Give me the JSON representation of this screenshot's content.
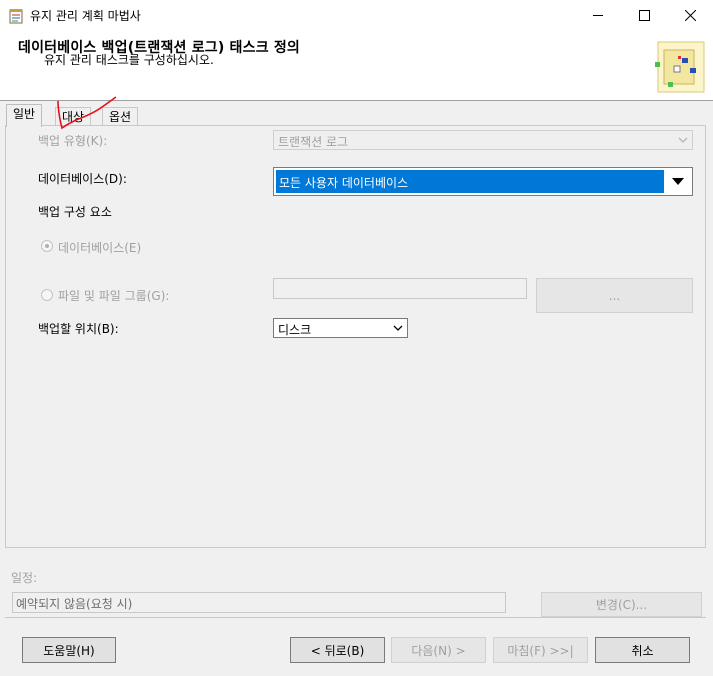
{
  "window": {
    "title": "유지 관리 계획 마법사",
    "icon": "wizard-app-icon",
    "controls": [
      "minimize-icon",
      "maximize-icon",
      "close-icon"
    ]
  },
  "header": {
    "title": "데이터베이스 백업(트랜잭션 로그) 태스크 정의",
    "subtitle": "유지 관리 태스크를 구성하십시오."
  },
  "tabs": [
    {
      "label": "일반",
      "selected": true
    },
    {
      "label": "대상",
      "selected": false
    },
    {
      "label": "옵션",
      "selected": false
    }
  ],
  "form": {
    "backup_type": {
      "label": "백업 유형(K):",
      "value": "트랜잭션 로그",
      "enabled": false
    },
    "database": {
      "label": "데이터베이스(D):",
      "value": "모든 사용자 데이터베이스"
    },
    "backup_component": {
      "label": "백업 구성 요소"
    },
    "radio_database": {
      "label": "데이터베이스(E)",
      "checked": true,
      "enabled": false
    },
    "radio_files": {
      "label": "파일 및 파일 그룹(G):",
      "checked": false,
      "enabled": false,
      "value": ""
    },
    "browse_button": {
      "label": "...",
      "enabled": false
    },
    "backup_to": {
      "label": "백업할 위치(B):",
      "value": "디스크"
    }
  },
  "schedule": {
    "label": "일정:",
    "value": "예약되지 않음(요청 시)",
    "change_button": "변경(C)..."
  },
  "buttons": {
    "help": "도움말(H)",
    "back": "< 뒤로(B)",
    "next": "다음(N) >",
    "finish": "마침(F) >>|",
    "cancel": "취소"
  },
  "colors": {
    "selection": "#0078d7",
    "annotation": "#e8101a"
  }
}
